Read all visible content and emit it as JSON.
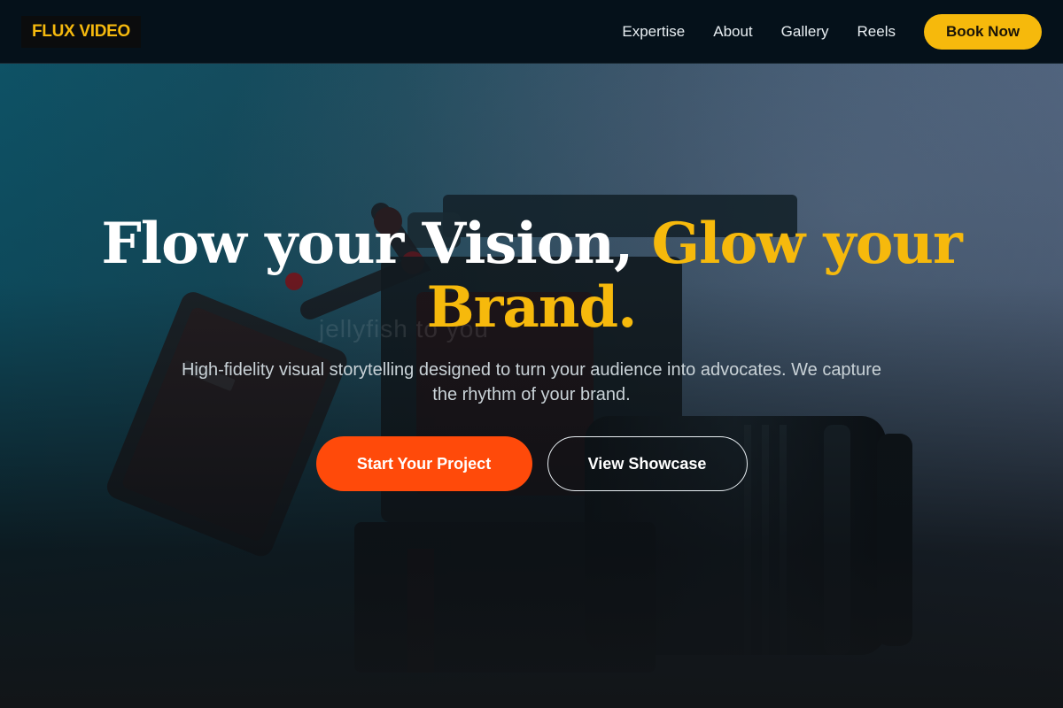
{
  "brand": {
    "logo_text": "FLUX VIDEO"
  },
  "nav": {
    "items": [
      {
        "label": "Expertise"
      },
      {
        "label": "About"
      },
      {
        "label": "Gallery"
      },
      {
        "label": "Reels"
      }
    ],
    "cta_label": "Book Now"
  },
  "hero": {
    "headline_part1": "Flow your Vision, ",
    "headline_accent": "Glow your Brand.",
    "subtitle": "High-fidelity visual storytelling designed to turn your audience into advocates. We capture the rhythm of your brand.",
    "watermark_text": "jellyfish to you",
    "primary_button": "Start Your Project",
    "secondary_button": "View Showcase",
    "background_image": "video-camera-rig-photo"
  },
  "colors": {
    "accent": "#f6b90c",
    "primary_cta": "#ff4a0a",
    "nav_bg": "#05111a"
  }
}
